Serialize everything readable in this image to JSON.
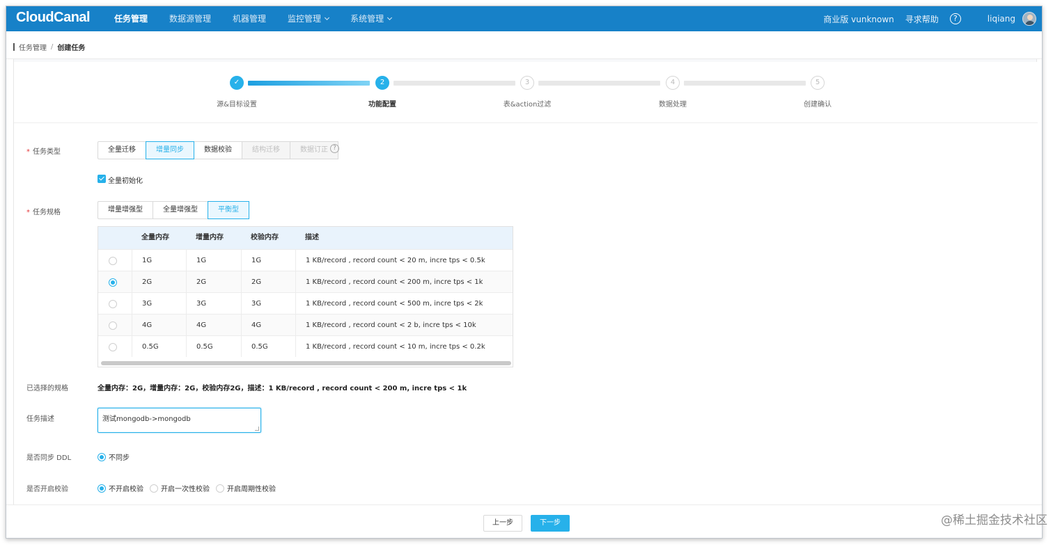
{
  "app": {
    "logo": "CloudCanal",
    "nav": [
      "任务管理",
      "数据源管理",
      "机器管理",
      "监控管理",
      "系统管理"
    ],
    "active_nav": "任务管理",
    "edition": "商业版 vunknown",
    "help": "寻求帮助",
    "help_icon": "?",
    "user": "liqiang"
  },
  "breadcrumb": {
    "parent": "任务管理",
    "sep": "/",
    "current": "创建任务"
  },
  "steps": [
    {
      "num": "✓",
      "label": "源&目标设置",
      "state": "done"
    },
    {
      "num": "2",
      "label": "功能配置",
      "state": "current"
    },
    {
      "num": "3",
      "label": "表&action过滤",
      "state": "todo"
    },
    {
      "num": "4",
      "label": "数据处理",
      "state": "todo"
    },
    {
      "num": "5",
      "label": "创建确认",
      "state": "todo"
    }
  ],
  "form": {
    "task_type": {
      "label": "任务类型",
      "required": "*",
      "options": [
        "全量迁移",
        "增量同步",
        "数据校验",
        "结构迁移",
        "数据订正"
      ],
      "selected": "增量同步",
      "disabled": [
        "结构迁移",
        "数据订正"
      ],
      "help_icon": "?"
    },
    "full_init": {
      "label": "全量初始化",
      "checked": true
    },
    "task_spec": {
      "label": "任务规格",
      "required": "*",
      "options": [
        "增量增强型",
        "全量增强型",
        "平衡型"
      ],
      "selected": "平衡型"
    },
    "spec_table": {
      "columns": [
        "全量内存",
        "增量内存",
        "校验内存",
        "描述"
      ],
      "rows": [
        {
          "full": "1G",
          "incr": "1G",
          "check": "1G",
          "desc": "1 KB/record , record count < 20 m, incre tps < 0.5k",
          "selected": false
        },
        {
          "full": "2G",
          "incr": "2G",
          "check": "2G",
          "desc": "1 KB/record , record count < 200 m, incre tps < 1k",
          "selected": true
        },
        {
          "full": "3G",
          "incr": "3G",
          "check": "3G",
          "desc": "1 KB/record , record count < 500 m, incre tps < 2k",
          "selected": false
        },
        {
          "full": "4G",
          "incr": "4G",
          "check": "4G",
          "desc": "1 KB/record , record count < 2 b, incre tps < 10k",
          "selected": false
        },
        {
          "full": "0.5G",
          "incr": "0.5G",
          "check": "0.5G",
          "desc": "1 KB/record , record count < 10 m, incre tps < 0.2k",
          "selected": false
        }
      ]
    },
    "selected_spec": {
      "label": "已选择的规格",
      "value": "全量内存：2G，增量内存：2G，校验内存2G，描述：1 KB/record , record count < 200 m, incre tps < 1k"
    },
    "task_desc": {
      "label": "任务描述",
      "value": "测试mongodb->mongodb"
    },
    "sync_ddl": {
      "label": "是否同步 DDL",
      "options": [
        "不同步"
      ],
      "selected": "不同步"
    },
    "enable_check": {
      "label": "是否开启校验",
      "options": [
        "不开启校验",
        "开启一次性校验",
        "开启周期性校验"
      ],
      "selected": "不开启校验"
    }
  },
  "footer": {
    "prev": "上一步",
    "next": "下一步"
  },
  "watermark": "@稀土掘金技术社区",
  "colors": {
    "topbar": "#1781c8",
    "accent": "#27b1ea",
    "required": "#e4393c"
  }
}
